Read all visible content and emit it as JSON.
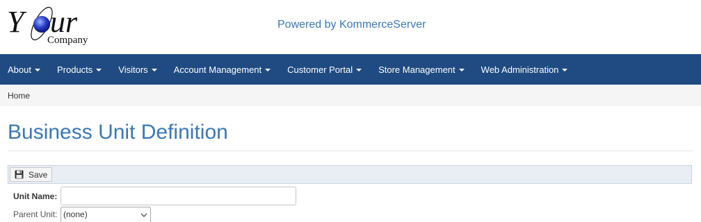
{
  "header": {
    "logo": {
      "word": "Your",
      "subword": "Company"
    },
    "powered_by": "Powered by KommerceServer"
  },
  "nav": {
    "items": [
      {
        "label": "About"
      },
      {
        "label": "Products"
      },
      {
        "label": "Visitors"
      },
      {
        "label": "Account Management"
      },
      {
        "label": "Customer Portal"
      },
      {
        "label": "Store Management"
      },
      {
        "label": "Web Administration"
      }
    ]
  },
  "breadcrumb": {
    "home": "Home"
  },
  "page": {
    "title": "Business Unit Definition"
  },
  "toolbar": {
    "save_label": "Save",
    "save_icon": "floppy-disk-icon"
  },
  "form": {
    "unit_name_label": "Unit Name:",
    "unit_name_value": "",
    "parent_unit_label": "Parent Unit:",
    "parent_unit_selected": "(none)"
  },
  "colors": {
    "navbar": "#1f4b82",
    "title": "#3a78b5",
    "breadcrumb_bg": "#f5f5f5",
    "toolbar_bg": "#e9eef5"
  }
}
